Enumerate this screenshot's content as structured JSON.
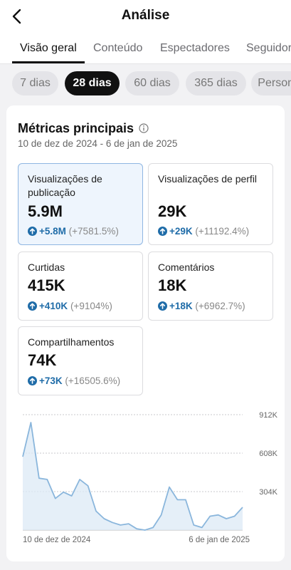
{
  "header": {
    "title": "Análise"
  },
  "tabs": [
    {
      "label": "Visão geral",
      "active": true
    },
    {
      "label": "Conteúdo",
      "active": false
    },
    {
      "label": "Espectadores",
      "active": false
    },
    {
      "label": "Seguidores",
      "active": false
    }
  ],
  "ranges": [
    {
      "label": "7 dias",
      "active": false
    },
    {
      "label": "28 dias",
      "active": true
    },
    {
      "label": "60 dias",
      "active": false
    },
    {
      "label": "365 dias",
      "active": false
    },
    {
      "label": "Personalizado",
      "active": false
    }
  ],
  "section": {
    "title": "Métricas principais",
    "date_range": "10 de dez de 2024 - 6 de jan de 2025"
  },
  "metrics": [
    {
      "label": "Visualizações de publicação",
      "value": "5.9M",
      "delta": "+5.8M",
      "pct": "(+7581.5%)",
      "selected": true
    },
    {
      "label": "Visualizações de perfil",
      "value": "29K",
      "delta": "+29K",
      "pct": "(+11192.4%)",
      "selected": false
    },
    {
      "label": "Curtidas",
      "value": "415K",
      "delta": "+410K",
      "pct": "(+9104%)",
      "selected": false
    },
    {
      "label": "Comentários",
      "value": "18K",
      "delta": "+18K",
      "pct": "(+6962.7%)",
      "selected": false
    },
    {
      "label": "Compartilhamentos",
      "value": "74K",
      "delta": "+73K",
      "pct": "(+16505.6%)",
      "selected": false
    }
  ],
  "colors": {
    "accent": "#1f6ca8",
    "line": "#8ab6dc",
    "fill": "#dce9f5"
  },
  "chart_data": {
    "type": "area",
    "y_ticks": [
      "912K",
      "608K",
      "304K"
    ],
    "ylim": [
      0,
      912000
    ],
    "x_labels": [
      "10 de dez de 2024",
      "6 de jan de 2025"
    ],
    "x": [
      "10 dez",
      "11 dez",
      "12 dez",
      "13 dez",
      "14 dez",
      "15 dez",
      "16 dez",
      "17 dez",
      "18 dez",
      "19 dez",
      "20 dez",
      "21 dez",
      "22 dez",
      "23 dez",
      "24 dez",
      "25 dez",
      "26 dez",
      "27 dez",
      "28 dez",
      "29 dez",
      "30 dez",
      "31 dez",
      "1 jan",
      "2 jan",
      "3 jan",
      "4 jan",
      "5 jan",
      "6 jan"
    ],
    "values": [
      580000,
      850000,
      410000,
      400000,
      250000,
      300000,
      270000,
      400000,
      350000,
      150000,
      90000,
      60000,
      40000,
      50000,
      10000,
      0,
      20000,
      120000,
      340000,
      240000,
      240000,
      40000,
      20000,
      110000,
      120000,
      90000,
      110000,
      180000
    ],
    "grid": true
  }
}
